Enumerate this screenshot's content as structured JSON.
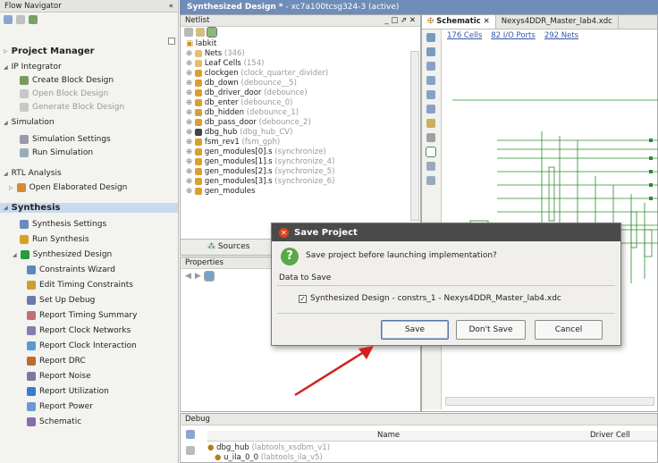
{
  "nav": {
    "header": "Flow Navigator",
    "collapse": "«",
    "items": [
      {
        "label": "Project Manager",
        "kind": "section",
        "arrow": "▷",
        "icon": ""
      },
      {
        "label": "IP Integrator",
        "kind": "group",
        "arrow": "◢",
        "icon": ""
      },
      {
        "label": "Create Block Design",
        "kind": "item",
        "icon": "create-block-icon"
      },
      {
        "label": "Open Block Design",
        "kind": "disabled",
        "icon": "open-block-icon"
      },
      {
        "label": "Generate Block Design",
        "kind": "disabled",
        "icon": "generate-block-icon"
      },
      {
        "label": "Simulation",
        "kind": "group",
        "arrow": "◢",
        "icon": ""
      },
      {
        "label": "Simulation Settings",
        "kind": "item",
        "icon": "sim-settings-icon"
      },
      {
        "label": "Run Simulation",
        "kind": "item",
        "icon": "run-sim-icon"
      },
      {
        "label": "RTL Analysis",
        "kind": "group",
        "arrow": "◢",
        "icon": ""
      },
      {
        "label": "Open Elaborated Design",
        "kind": "item",
        "arrow": "▷",
        "icon": "elaborated-icon"
      },
      {
        "label": "Synthesis",
        "kind": "section-selected",
        "arrow": "◢",
        "icon": ""
      },
      {
        "label": "Synthesis Settings",
        "kind": "item",
        "icon": "synth-settings-icon"
      },
      {
        "label": "Run Synthesis",
        "kind": "item",
        "icon": "run-synth-icon"
      },
      {
        "label": "Synthesized Design",
        "kind": "item",
        "arrow": "◢",
        "icon": "synth-design-icon"
      },
      {
        "label": "Constraints Wizard",
        "kind": "item2",
        "icon": "constraints-icon"
      },
      {
        "label": "Edit Timing Constraints",
        "kind": "item2",
        "icon": "edit-timing-icon"
      },
      {
        "label": "Set Up Debug",
        "kind": "item2",
        "icon": "debug-setup-icon"
      },
      {
        "label": "Report Timing Summary",
        "kind": "item2",
        "icon": "report-timing-icon"
      },
      {
        "label": "Report Clock Networks",
        "kind": "item2",
        "icon": "report-clock-net-icon"
      },
      {
        "label": "Report Clock Interaction",
        "kind": "item2",
        "icon": "report-clock-int-icon"
      },
      {
        "label": "Report DRC",
        "kind": "item2",
        "icon": "report-drc-icon"
      },
      {
        "label": "Report Noise",
        "kind": "item2",
        "icon": "report-noise-icon"
      },
      {
        "label": "Report Utilization",
        "kind": "item2",
        "icon": "report-util-icon"
      },
      {
        "label": "Report Power",
        "kind": "item2",
        "icon": "report-power-icon"
      },
      {
        "label": "Schematic",
        "kind": "item2",
        "icon": "schematic-icon"
      }
    ]
  },
  "title_bar": {
    "name": "Synthesized Design *",
    "detail": " - xc7a100tcsg324-3 (active)"
  },
  "netlist": {
    "title": "Netlist",
    "controls": "_ □ ⇗ ✕",
    "root": "labkit",
    "rows": [
      {
        "name": "Nets",
        "extra": "(346)"
      },
      {
        "name": "Leaf Cells",
        "extra": "(154)"
      },
      {
        "name": "clockgen",
        "extra": "(clock_quarter_divider)"
      },
      {
        "name": "db_down",
        "extra": "(debounce__5)"
      },
      {
        "name": "db_driver_door",
        "extra": "(debounce)"
      },
      {
        "name": "db_enter",
        "extra": "(debounce_0)"
      },
      {
        "name": "db_hidden",
        "extra": "(debounce_1)"
      },
      {
        "name": "db_pass_door",
        "extra": "(debounce_2)"
      },
      {
        "name": "dbg_hub",
        "extra": "(dbg_hub_CV)"
      },
      {
        "name": "fsm_rev1",
        "extra": "(fsm_gph)"
      },
      {
        "name": "gen_modules[0].s",
        "extra": "(synchronize)"
      },
      {
        "name": "gen_modules[1].s",
        "extra": "(synchronize_4)"
      },
      {
        "name": "gen_modules[2].s",
        "extra": "(synchronize_5)"
      },
      {
        "name": "gen_modules[3].s",
        "extra": "(synchronize_6)"
      },
      {
        "name": "gen_modules",
        "extra": ""
      }
    ],
    "tab_sources": "Sources"
  },
  "properties": {
    "title": "Properties"
  },
  "schematic": {
    "tab1": "Schematic",
    "tab2": "Nexys4DDR_Master_lab4.xdc",
    "cells": "176 Cells",
    "ports": "82 I/O Ports",
    "nets": "292 Nets"
  },
  "debug": {
    "title": "Debug",
    "col_name": "Name",
    "col_driver": "Driver Cell",
    "row1": "dbg_hub",
    "row1_extra": "(labtools_xsdbm_v1)",
    "row2": "u_ila_0_0",
    "row2_extra": "(labtools_ila_v5)"
  },
  "dialog": {
    "title": "Save Project",
    "question": "Save project before launching implementation?",
    "section": "Data to Save",
    "item": "Synthesized Design - constrs_1 - Nexys4DDR_Master_lab4.xdc",
    "save": "Save",
    "dont_save": "Don't Save",
    "cancel": "Cancel"
  },
  "colors": {
    "title_bar": "#6f8db9",
    "arrow": "#d02020",
    "selection": "#c9d9ee"
  }
}
